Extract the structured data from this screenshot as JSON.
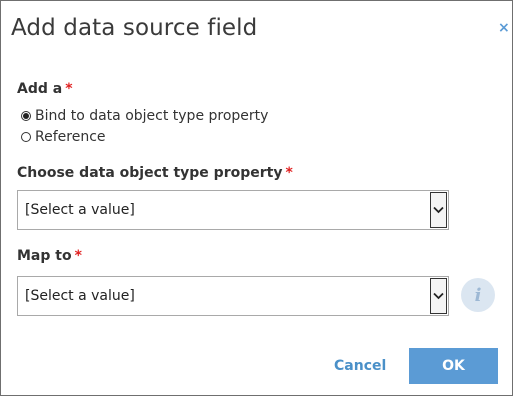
{
  "dialog": {
    "title": "Add data source field",
    "close_icon": "×"
  },
  "add_a": {
    "label": "Add a",
    "required": "*",
    "options": [
      {
        "label": "Bind to data object type property",
        "selected": true
      },
      {
        "label": "Reference",
        "selected": false
      }
    ]
  },
  "choose_property": {
    "label": "Choose data object type property",
    "required": "*",
    "value": "[Select a value]"
  },
  "map_to": {
    "label": "Map to",
    "required": "*",
    "value": "[Select a value]",
    "info_icon": "i"
  },
  "footer": {
    "cancel_label": "Cancel",
    "ok_label": "OK"
  },
  "colors": {
    "accent": "#5b9bd5",
    "required": "#e02020"
  }
}
